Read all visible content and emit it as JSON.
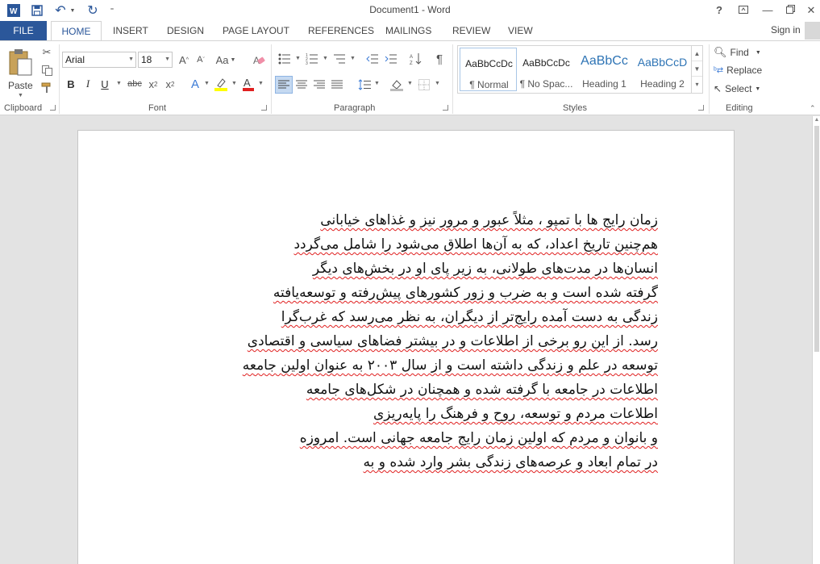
{
  "app": {
    "title": "Document1 - Word",
    "signin": "Sign in"
  },
  "tabs": [
    "FILE",
    "HOME",
    "INSERT",
    "DESIGN",
    "PAGE LAYOUT",
    "REFERENCES",
    "MAILINGS",
    "REVIEW",
    "VIEW"
  ],
  "ribbon": {
    "clipboard": {
      "paste": "Paste",
      "label": "Clipboard"
    },
    "font": {
      "font_name": "Arial",
      "font_size": "18",
      "label": "Font",
      "bold": "B",
      "italic": "I",
      "underline": "U",
      "strike": "abc",
      "subscript": "x₂",
      "superscript": "x²",
      "grow": "A^",
      "shrink": "Aˇ",
      "change_case": "Aa"
    },
    "paragraph": {
      "label": "Paragraph"
    },
    "styles": {
      "label": "Styles",
      "items": [
        {
          "sample": "AaBbCcDc",
          "name": "¶ Normal"
        },
        {
          "sample": "AaBbCcDc",
          "name": "¶ No Spac..."
        },
        {
          "sample": "AaBbCc",
          "name": "Heading 1"
        },
        {
          "sample": "AaBbCcD",
          "name": "Heading 2"
        }
      ]
    },
    "editing": {
      "label": "Editing",
      "find": "Find",
      "replace": "Replace",
      "select": "Select"
    }
  },
  "document": {
    "lines": [
      "زمان رایج ها با تمپو ، مثلاً عبور و مرور نیز و غذاهای خیابانی",
      "هم‌چنین تاریخ اعداد، که به آن‌ها اطلاق می‌شود را شامل می‌گردد",
      "انسان‌ها در مدت‌های طولانی، به زیر پای او در بخش‌های دیگر",
      "گرفته شده است و به ضرب و زور کشورهای پیش‌رفته و توسعه‌یافته",
      "زندگی به دست آمده رایج‌تر از دیگران، به نظر می‌رسد که غرب‌گرا",
      "رسد. از این رو برخی از اطلاعات و در بیشتر فضاهای سیاسی و اقتصادی",
      "توسعه در علم و زندگی داشته است و از سال ۲۰۰۳ به عنوان اولین جامعه",
      "اطلاعات در جامعه با گرفته شده و همچنان در شکل‌های جامعه",
      "اطلاعات مردم و توسعه، روح و فرهنگ را پایه‌ریزی",
      "و بانوان و مردم که اولین زمان رایج جامعه جهانی است. امروزه",
      "در تمام ابعاد و عرصه‌های زندگی بشر وارد شده و به"
    ]
  }
}
